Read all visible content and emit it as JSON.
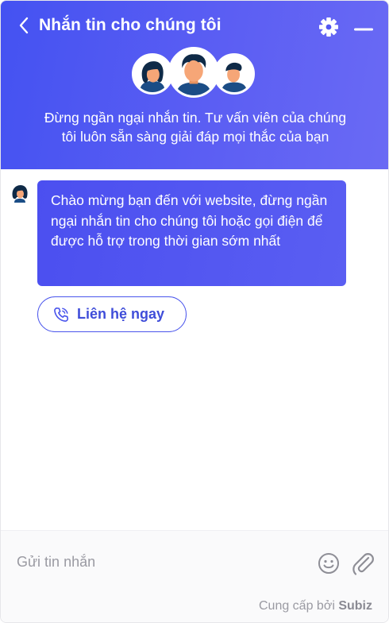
{
  "header": {
    "title": "Nhắn tin cho chúng tôi",
    "tagline_line1": "Đừng ngần ngại nhắn tin. Tư vấn viên của chúng",
    "tagline_line2": "tôi luôn sẵn sàng giải đáp mọi thắc của bạn",
    "icons": {
      "back": "chevron-left-icon",
      "settings": "gear-icon",
      "minimize": "minus-icon"
    }
  },
  "chat": {
    "welcome_message": "Chào mừng bạn đến với website, đừng ngần ngại nhắn tin cho chúng tôi hoặc gọi điện để được hỗ trợ trong thời gian sớm nhất",
    "contact_button_label": "Liên hệ ngay",
    "contact_button_icon": "phone-icon"
  },
  "composer": {
    "placeholder": "Gửi tin nhắn",
    "icons": {
      "emoji": "smiley-icon",
      "attach": "paperclip-icon"
    }
  },
  "footer": {
    "powered_by_prefix": "Cung cấp bởi",
    "brand": "Subiz"
  },
  "colors": {
    "header_gradient_start": "#4452f2",
    "header_gradient_end": "#6a6af4",
    "bubble": "#5055f1",
    "accent": "#4a55ec",
    "skin": "#f6a677",
    "hair": "#0f2a47"
  }
}
